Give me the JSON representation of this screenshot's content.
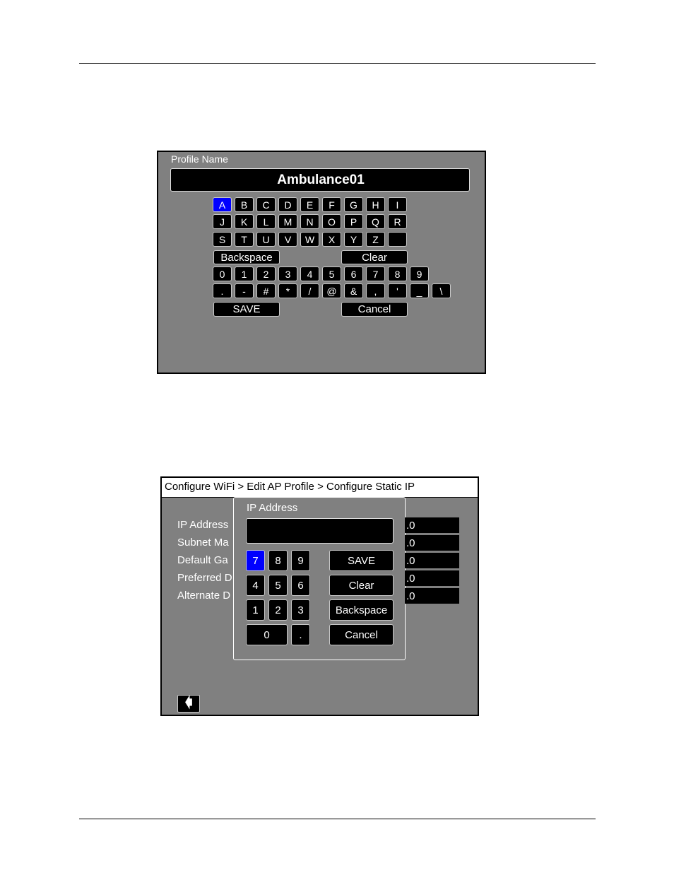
{
  "profile_keyboard": {
    "title": "Profile Name",
    "value": "Ambulance01",
    "selected_key": "A",
    "rows": [
      [
        "A",
        "B",
        "C",
        "D",
        "E",
        "F",
        "G",
        "H",
        "I"
      ],
      [
        "J",
        "K",
        "L",
        "M",
        "N",
        "O",
        "P",
        "Q",
        "R"
      ],
      [
        "S",
        "T",
        "U",
        "V",
        "W",
        "X",
        "Y",
        "Z",
        " "
      ],
      [
        "0",
        "1",
        "2",
        "3",
        "4",
        "5",
        "6",
        "7",
        "8",
        "9"
      ],
      [
        ".",
        "-",
        "#",
        "*",
        "/",
        "@",
        "&",
        ",",
        "'",
        "_",
        "\\"
      ]
    ],
    "backspace_label": "Backspace",
    "clear_label": "Clear",
    "save_label": "SAVE",
    "cancel_label": "Cancel"
  },
  "static_ip": {
    "breadcrumb": "Configure WiFi > Edit AP Profile > Configure Static IP",
    "labels": [
      "IP Address",
      "Subnet Ma",
      "Default Ga",
      "Preferred D",
      "Alternate D"
    ],
    "field_values": [
      ".0",
      ".0",
      ".0",
      ".0",
      ".0"
    ],
    "dialog": {
      "title": "IP Address",
      "value": "",
      "selected_key": "7",
      "numpad": [
        [
          "7",
          "8",
          "9"
        ],
        [
          "4",
          "5",
          "6"
        ],
        [
          "1",
          "2",
          "3"
        ],
        [
          "0",
          "."
        ]
      ],
      "save_label": "SAVE",
      "clear_label": "Clear",
      "backspace_label": "Backspace",
      "cancel_label": "Cancel"
    },
    "back_icon": "arrow-left-icon"
  },
  "colors": {
    "panel": "#808080",
    "key": "#000000",
    "selected": "#0000ff"
  }
}
